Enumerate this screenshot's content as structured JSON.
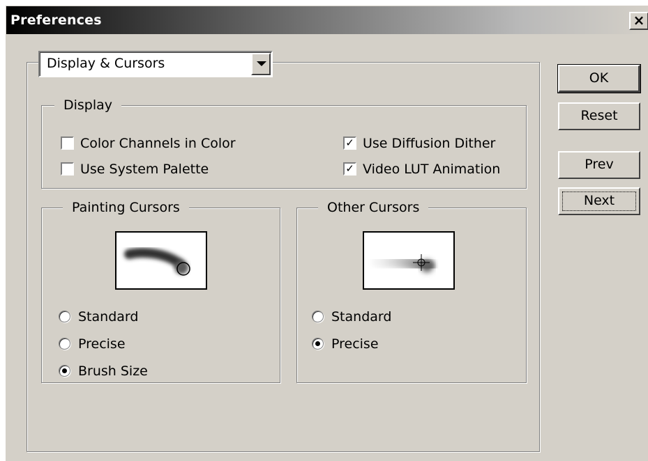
{
  "window": {
    "title": "Preferences",
    "close_glyph": "×"
  },
  "section_dropdown": {
    "value": "Display & Cursors"
  },
  "display_group": {
    "label": "Display",
    "checkboxes": [
      {
        "label": "Color Channels in Color",
        "checked": false
      },
      {
        "label": "Use System Palette",
        "checked": false
      },
      {
        "label": "Use Diffusion Dither",
        "checked": true
      },
      {
        "label": "Video LUT Animation",
        "checked": true
      }
    ]
  },
  "painting_cursors": {
    "label": "Painting Cursors",
    "preview_icon": "brush-stroke-circle-preview",
    "options": [
      {
        "label": "Standard",
        "selected": false
      },
      {
        "label": "Precise",
        "selected": false
      },
      {
        "label": "Brush Size",
        "selected": true
      }
    ]
  },
  "other_cursors": {
    "label": "Other Cursors",
    "preview_icon": "crosshair-preview",
    "options": [
      {
        "label": "Standard",
        "selected": false
      },
      {
        "label": "Precise",
        "selected": true
      }
    ]
  },
  "buttons": {
    "ok": "OK",
    "reset": "Reset",
    "prev": "Prev",
    "next": "Next"
  },
  "check_glyph": "✓"
}
